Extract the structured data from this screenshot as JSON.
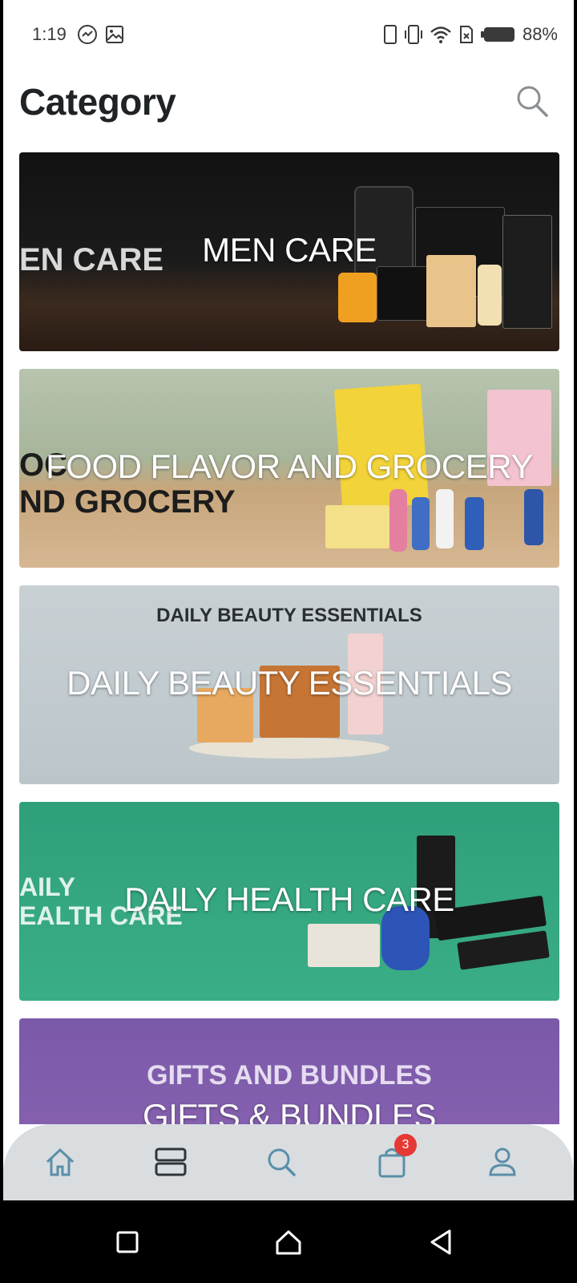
{
  "status_bar": {
    "time": "1:19",
    "battery": "88%",
    "left_icons": [
      "messenger-icon",
      "gallery-icon"
    ],
    "right_icons": [
      "phone-icon",
      "vibrate-icon",
      "wifi-icon",
      "sim-icon",
      "battery-icon"
    ]
  },
  "header": {
    "title": "Category",
    "search_icon": "search-icon"
  },
  "categories": [
    {
      "label": "MEN CARE",
      "banner_text": "EN CARE",
      "colors": [
        "#1a1a1a",
        "#3a2a20"
      ]
    },
    {
      "label": "FOOD FLAVOR AND GROCERY",
      "banner_text_1": "OC",
      "banner_text_2": "ND GROCERY",
      "colors": [
        "#a9b8a0",
        "#c9a87d"
      ]
    },
    {
      "label": "DAILY BEAUTY ESSENTIALS",
      "banner_text": "DAILY BEAUTY ESSENTIALS",
      "colors": [
        "#c9d2d6",
        "#b7c1c5"
      ]
    },
    {
      "label": "DAILY HEALTH CARE",
      "banner_text_1": "AILY",
      "banner_text_2": "EALTH CARE",
      "colors": [
        "#2fa27a",
        "#3cae86"
      ]
    },
    {
      "label": "GIFTS & BUNDLES",
      "banner_text": "GIFTS AND BUNDLES",
      "colors": [
        "#7c5aaa",
        "#8d67b5"
      ]
    }
  ],
  "bottom_nav": {
    "items": [
      "home-icon",
      "categories-icon",
      "search-icon",
      "cart-icon",
      "profile-icon"
    ],
    "cart_badge": "3",
    "accent": "#5a8fa8"
  },
  "system_nav": [
    "recents-button",
    "home-button",
    "back-button"
  ]
}
